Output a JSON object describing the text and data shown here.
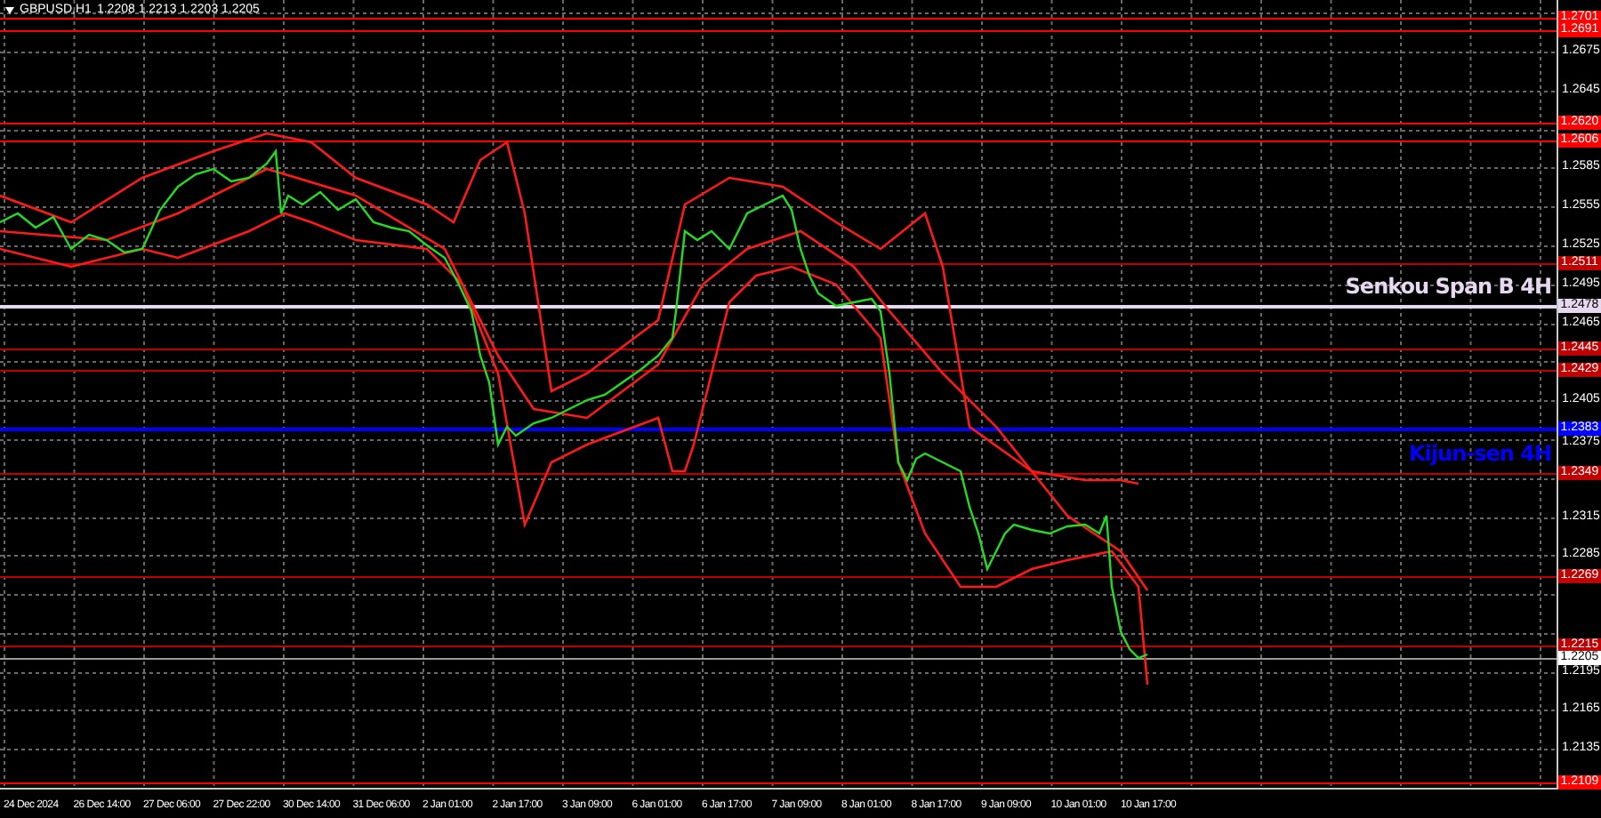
{
  "chart": {
    "symbol": "GBPUSD,H1",
    "quote": "1.2208 1.2213 1.2203 1.2205"
  },
  "y_axis": {
    "ticks": [
      "1.2675",
      "1.2645",
      "1.2585",
      "1.2555",
      "1.2525",
      "1.2495",
      "1.2465",
      "1.2405",
      "1.2375",
      "1.2315",
      "1.2285",
      "1.2195",
      "1.2165",
      "1.2135"
    ]
  },
  "x_axis": {
    "labels": [
      "24 Dec 2024",
      "26 Dec 14:00",
      "27 Dec 06:00",
      "27 Dec 22:00",
      "30 Dec 14:00",
      "31 Dec 06:00",
      "2 Jan 01:00",
      "2 Jan 17:00",
      "3 Jan 09:00",
      "6 Jan 01:00",
      "6 Jan 17:00",
      "7 Jan 09:00",
      "8 Jan 01:00",
      "8 Jan 17:00",
      "9 Jan 09:00",
      "10 Jan 01:00",
      "10 Jan 17:00"
    ]
  },
  "levels": [
    {
      "label": "1.2701",
      "kind": "level",
      "color": "#ff0000"
    },
    {
      "label": "1.2691",
      "kind": "level",
      "color": "#ff0000"
    },
    {
      "label": "1.2620",
      "kind": "level",
      "color": "#ff0000"
    },
    {
      "label": "1.2606",
      "kind": "level",
      "color": "#ff0000"
    },
    {
      "label": "1.2511",
      "kind": "level",
      "color": "#c00000"
    },
    {
      "label": "1.2478",
      "kind": "senkou",
      "color": "#e6d8ee",
      "name": "Senkou Span B 4H"
    },
    {
      "label": "1.2445",
      "kind": "level",
      "color": "#c00000"
    },
    {
      "label": "1.2429",
      "kind": "level",
      "color": "#c00000"
    },
    {
      "label": "1.2383",
      "kind": "kijun",
      "color": "#0000ff",
      "name": "Kijun-sen 4H"
    },
    {
      "label": "1.2349",
      "kind": "level",
      "color": "#c00000"
    },
    {
      "label": "1.2269",
      "kind": "level",
      "color": "#c00000"
    },
    {
      "label": "1.2215",
      "kind": "level",
      "color": "#c00000"
    },
    {
      "label": "1.2205",
      "kind": "current",
      "color": "#ffffff"
    },
    {
      "label": "1.2109",
      "kind": "level",
      "color": "#ff0000"
    }
  ]
}
